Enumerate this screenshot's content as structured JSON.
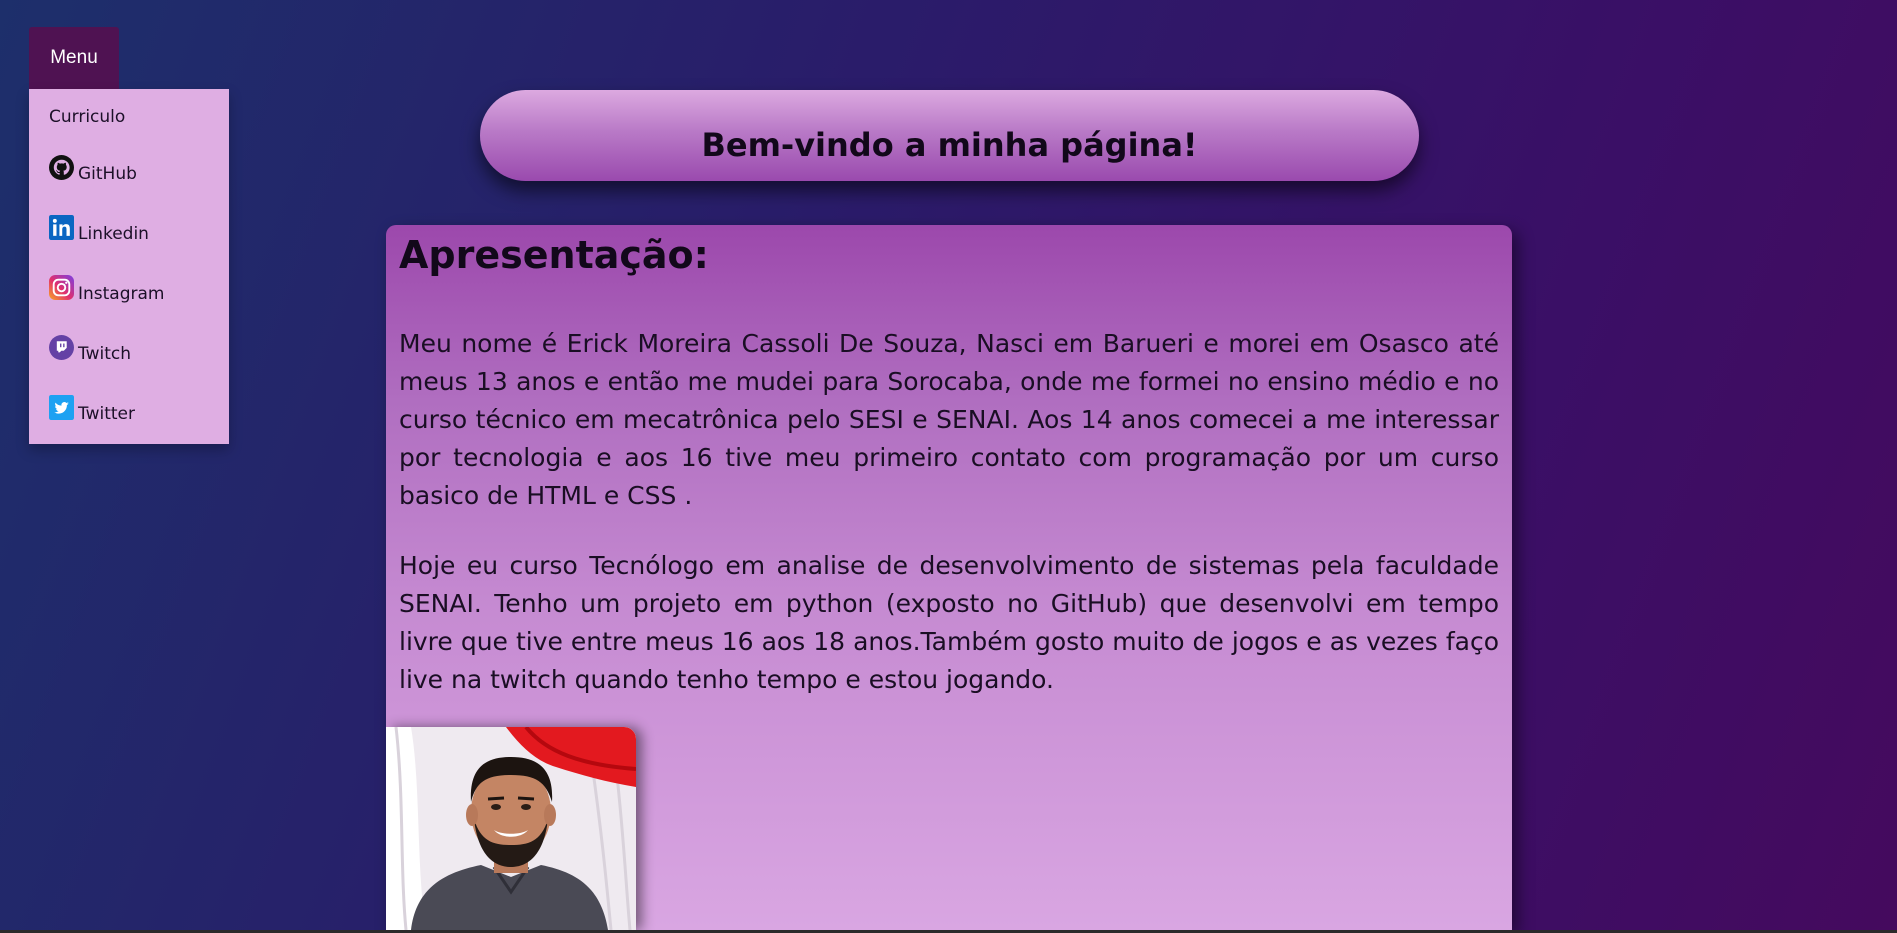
{
  "menu": {
    "button_label": "Menu",
    "items": [
      {
        "label": "Curriculo",
        "icon": "none"
      },
      {
        "label": "GitHub",
        "icon": "github-icon"
      },
      {
        "label": "Linkedin",
        "icon": "linkedin-icon"
      },
      {
        "label": "Instagram",
        "icon": "instagram-icon"
      },
      {
        "label": "Twitch",
        "icon": "twitch-icon"
      },
      {
        "label": "Twitter",
        "icon": "twitter-icon"
      }
    ]
  },
  "header": {
    "title": "Bem-vindo a minha página!"
  },
  "presentation": {
    "title": "Apresentação:",
    "paragraphs": [
      "Meu nome é Erick Moreira Cassoli De Souza, Nasci em Barueri e morei em Osasco até meus 13 anos e então me mudei para Sorocaba, onde me formei no ensino médio e no curso técnico em mecatrônica pelo SESI e SENAI. Aos 14 anos comecei a me interessar por tecnologia e aos 16 tive meu primeiro contato com programação por um curso basico de HTML e CSS .",
      "Hoje eu curso Tecnólogo em analise de desenvolvimento de sistemas pela faculdade SENAI. Tenho um projeto em python (exposto no GitHub) que desenvolvi em tempo livre que tive entre meus 16 aos 18 anos.Também gosto muito de jogos e as vezes faço live na twitch quando tenho tempo e estou jogando."
    ]
  },
  "colors": {
    "menu_button": "#4f1252",
    "menu_dropdown": "#dfaee3",
    "card_top": "#9c48ac",
    "card_bottom": "#d9a6e2"
  }
}
